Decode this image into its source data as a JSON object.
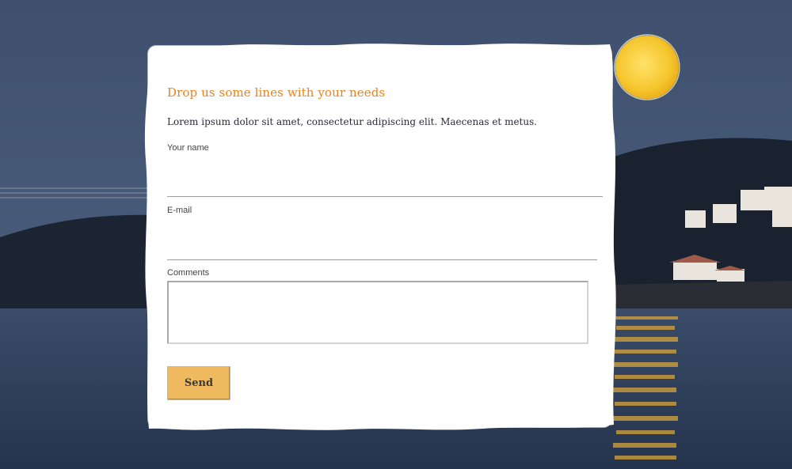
{
  "form": {
    "title": "Drop us some lines with your needs",
    "intro": "Lorem ipsum dolor sit amet, consectetur adipiscing elit. Maecenas et metus.",
    "name_label": "Your name",
    "name_value": "",
    "email_label": "E-mail",
    "email_value": "",
    "comments_label": "Comments",
    "comments_value": "",
    "send_label": "Send"
  },
  "colors": {
    "accent": "#e5841c",
    "button": "#eeb95f",
    "sky": "#3f526f",
    "moon": "#f7cf3a"
  }
}
